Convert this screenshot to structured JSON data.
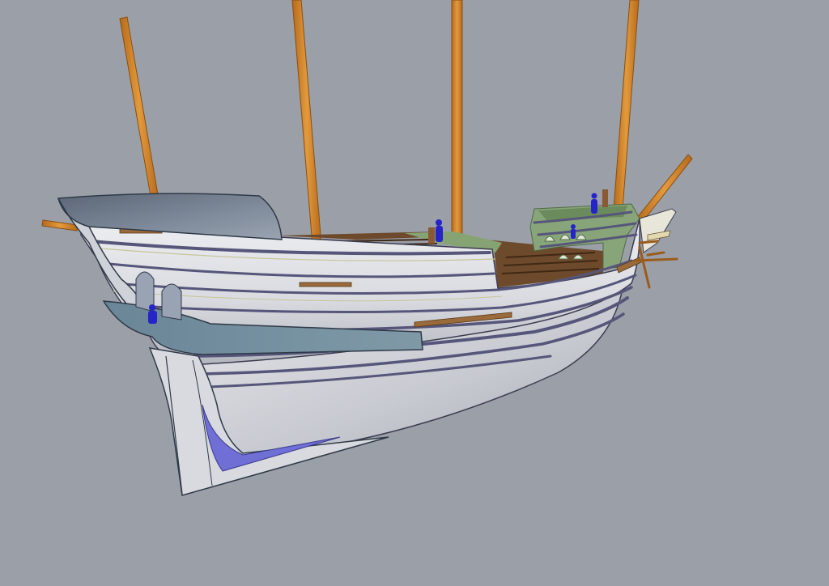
{
  "viewport": {
    "background": "#9ba0a8",
    "model": "ship-hull-3d-render"
  },
  "colors": {
    "hull_light": "#e4e5e9",
    "hull_mid": "#c9cbd2",
    "hull_shadow": "#aeb1ba",
    "wale_stripe": "#5a5a78",
    "upper_stern_gray": "#7f8a99",
    "stern_dark": "#4f5a6a",
    "gallery_blue": "#6f8a9b",
    "keel_blue": "#6f6fd6",
    "mast_orange": "#d8862a",
    "mast_dark": "#a85f16",
    "deck_wood": "#8a5a35",
    "deck_green": "#7f9a6a",
    "figure_blue": "#2424c8"
  },
  "masts": [
    "mizzen",
    "main-aft",
    "main",
    "fore"
  ],
  "figures": [
    "stern-figure",
    "deck-figure",
    "bow-figure"
  ]
}
